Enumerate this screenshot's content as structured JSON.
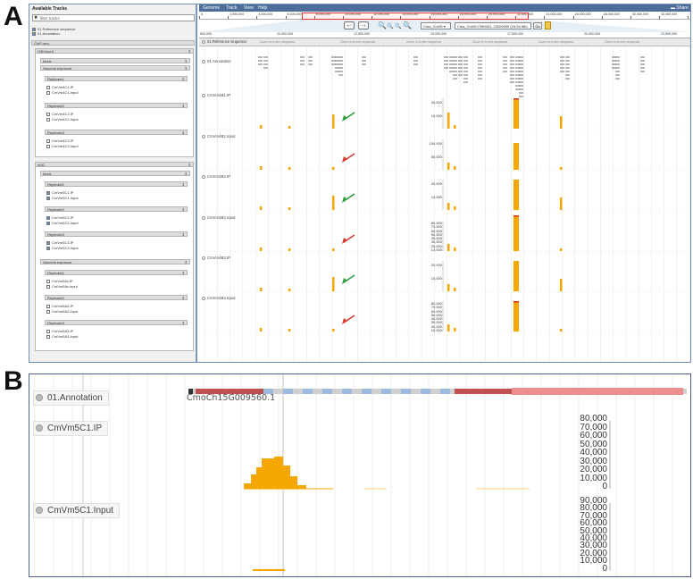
{
  "panels": {
    "a": "A",
    "b": "B"
  },
  "sidebar": {
    "title": "Available Tracks",
    "filter_placeholder": "filter tracks",
    "top_items": [
      "01 Reference sequence",
      "01.Annotation"
    ],
    "category_root": "ChIP-seq",
    "groups": [
      {
        "name": "H3K4me3",
        "subgroups": [
          {
            "name": "Mock",
            "children": []
          },
          {
            "name": "Vaccinia exposure",
            "children": [
              {
                "name": "Replicate1",
                "tracks": [
                  "CmVm4C1.IP",
                  "CmVm4C1.Input"
                ],
                "checked": [
                  false,
                  false
                ]
              },
              {
                "name": "Replicate2",
                "tracks": [
                  "CmVm4C2.IP",
                  "CmVm4C2.Input"
                ],
                "checked": [
                  false,
                  false
                ]
              },
              {
                "name": "Replicate3",
                "tracks": [
                  "CmVm4C3.IP",
                  "CmVm4C3.Input"
                ],
                "checked": [
                  false,
                  false
                ]
              }
            ]
          }
        ]
      },
      {
        "name": "m5C",
        "subgroups": [
          {
            "name": "Mock",
            "children": [
              {
                "name": "Replicate1",
                "tracks": [
                  "CmVm5C1.IP",
                  "CmVm5C1.Input"
                ],
                "checked": [
                  true,
                  true
                ]
              },
              {
                "name": "Replicate2",
                "tracks": [
                  "CmVm5C2.IP",
                  "CmVm5C2.Input"
                ],
                "checked": [
                  true,
                  true
                ]
              },
              {
                "name": "Replicate3",
                "tracks": [
                  "CmVm5C3.IP",
                  "CmVm5C3.Input"
                ],
                "checked": [
                  true,
                  true
                ]
              }
            ]
          },
          {
            "name": "Vaccinia exposure",
            "children": [
              {
                "name": "Replicate1",
                "tracks": [
                  "CmVm5Av.IP",
                  "CmVm5Av.Input"
                ],
                "checked": [
                  false,
                  false
                ]
              },
              {
                "name": "Replicate2",
                "tracks": [
                  "CmVm5A2.IP",
                  "CmVm5A2.Input"
                ],
                "checked": [
                  false,
                  false
                ]
              },
              {
                "name": "Replicate3",
                "tracks": [
                  "CmVm5A3.IP",
                  "CmVm5A3.Input"
                ],
                "checked": [
                  false,
                  false
                ]
              }
            ]
          }
        ]
      }
    ]
  },
  "menu": [
    "Genome",
    "Track",
    "View",
    "Help"
  ],
  "share_label": "Share",
  "ruler_ticks": [
    "0",
    "2,000,000",
    "4,000,000",
    "6,000,000",
    "8,000,000",
    "10,000,000",
    "12,000,000",
    "14,000,000",
    "16,000,000",
    "18,000,000",
    "20,000,000",
    "22,000,000",
    "24,000,000",
    "26,000,000",
    "28,000,000",
    "30,000,000",
    "32,000,000",
    "34,000,000"
  ],
  "nav": {
    "back": "←",
    "forward": "→",
    "chrom_select": "Cma_Chr05",
    "location": "Cma_Chr05:7280001..23200000 (15.94 Mb)",
    "go": "Go"
  },
  "scale_ticks": [
    "500,000",
    "10,000,000",
    "12,500,000",
    "15,000,000",
    "17,500,000",
    "20,000,000",
    "22,500,000"
  ],
  "reference_label": "01.Reference sequence",
  "zoom_msg": "Zoom in to see sequence",
  "tracks": [
    "01.Annotation",
    "CmVm4B1.IP",
    "CmVm4B1.Input",
    "CmVm4B2.IP",
    "CmVm4B2.Input",
    "CmVm4B3.IP",
    "CmVm4B3.Input"
  ],
  "track_axes": [
    [
      "20,000",
      "10,000"
    ],
    [
      "100,000",
      "50,000"
    ],
    [
      "20,000",
      "10,000"
    ],
    [
      "80,000",
      "70,000",
      "60,000",
      "50,000",
      "40,000",
      "30,000",
      "20,000",
      "10,000"
    ],
    [
      "20,000",
      "10,000"
    ],
    [
      "80,000",
      "70,000",
      "60,000",
      "50,000",
      "40,000",
      "30,000",
      "20,000",
      "10,000"
    ]
  ],
  "arrows": [
    {
      "color": "#2e9e3c"
    },
    {
      "color": "#d23a2c"
    },
    {
      "color": "#2e9e3c"
    },
    {
      "color": "#d23a2c"
    },
    {
      "color": "#2e9e3c"
    },
    {
      "color": "#d23a2c"
    }
  ],
  "colors": {
    "signal": "#f5a700",
    "signal_peak": "#d9302b",
    "header": "#4d6d9a"
  },
  "panel_b": {
    "tracks": [
      "01.Annotation",
      "CmVm5C1.IP",
      "CmVm5C1.Input"
    ],
    "gene_label": "CmoCh15G009560.1",
    "ip_axis": [
      "80,000",
      "70,000",
      "60,000",
      "50,000",
      "40,000",
      "30,000",
      "20,000",
      "10,000",
      "0"
    ],
    "input_axis": [
      "90,000",
      "80,000",
      "70,000",
      "60,000",
      "50,000",
      "40,000",
      "30,000",
      "20,000",
      "10,000",
      "0"
    ]
  }
}
